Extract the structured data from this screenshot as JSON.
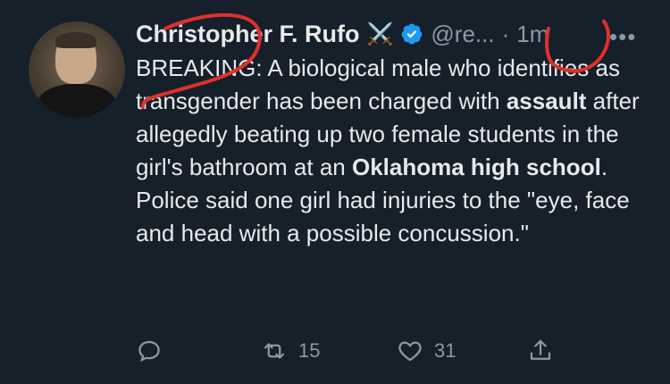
{
  "tweet": {
    "author_name": "Christopher F. Rufo",
    "emoji": "⚔️",
    "handle": "@re...",
    "separator": "·",
    "time": "1m",
    "more": "•••",
    "text_parts": {
      "p1": "BREAKING: A biological male who identifies as transgender has been charged with ",
      "b1": "assault",
      "p2": " after allegedly beating up two female students in the girl's bathroom at an ",
      "b2": "Oklahoma high school",
      "p3": ". Police said one girl had injuries to the \"eye, face and head with a possible concussion.\""
    },
    "actions": {
      "retweets": "15",
      "likes": "31"
    }
  },
  "colors": {
    "background": "#15202b",
    "text": "#e7e9ea",
    "muted": "#8b98a5",
    "verified": "#1d9bf0",
    "annotation": "#e0302b"
  },
  "icons": {
    "reply": "reply-icon",
    "retweet": "retweet-icon",
    "like": "heart-icon",
    "share": "share-icon",
    "verified": "verified-badge-icon"
  }
}
